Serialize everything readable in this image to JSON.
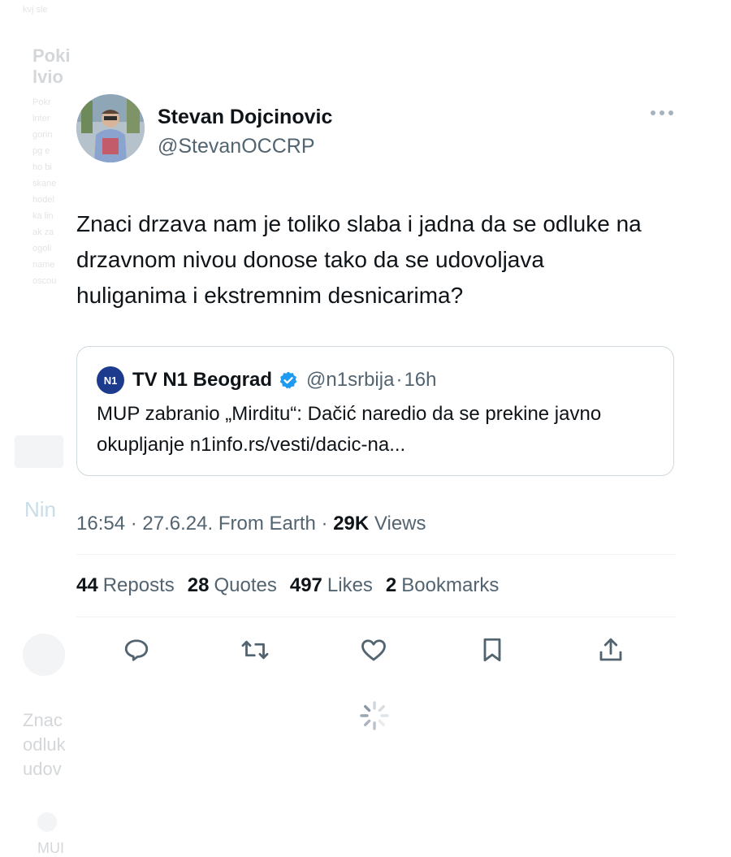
{
  "background_page": {
    "lines": [
      "Poki",
      "lvio",
      "Nin",
      "Znac",
      "odluk",
      "udov",
      "MUI"
    ],
    "excerpt_small": [
      "kvj sle",
      "Pokr",
      "lnter",
      "gorin",
      "pg e",
      "ho bi",
      "skane",
      "hodel",
      "ka lin",
      "ak za",
      "ogoli",
      "name",
      "oscou",
      "sergi"
    ]
  },
  "tweet": {
    "author": {
      "name": "Stevan Dojcinovic",
      "handle": "@StevanOCCRP",
      "avatar": "avatar-photo"
    },
    "more_icon": "more-horizontal-icon",
    "text": "Znaci drzava nam je toliko slaba i jadna da se odluke na drzavnom nivou donose tako da se udovoljava huliganima i ekstremnim desnicarima?",
    "quoted": {
      "logo_text": "N1",
      "name": "TV N1 Beograd",
      "verified": true,
      "handle": "@n1srbija",
      "separator": "·",
      "time": "16h",
      "text": "MUP zabranio „Mirditu“: Dačić naredio da se prekine javno okupljanje n1info.rs/vesti/dacic-na..."
    },
    "meta": {
      "time": "16:54",
      "date": "27.6.24.",
      "source": "From Earth",
      "views_count": "29K",
      "views_label": "Views",
      "separator": "·"
    },
    "stats": {
      "reposts_count": "44",
      "reposts_label": "Reposts",
      "quotes_count": "28",
      "quotes_label": "Quotes",
      "likes_count": "497",
      "likes_label": "Likes",
      "bookmarks_count": "2",
      "bookmarks_label": "Bookmarks"
    },
    "actions": [
      "reply-icon",
      "repost-icon",
      "like-icon",
      "bookmark-icon",
      "share-icon"
    ],
    "colors": {
      "text": "#0f1419",
      "secondary": "#536471",
      "verified": "#1d9bf0",
      "n1_brand": "#1d3b8c",
      "border": "#cfd9de"
    }
  },
  "loading_icon": "loading-spinner-icon"
}
